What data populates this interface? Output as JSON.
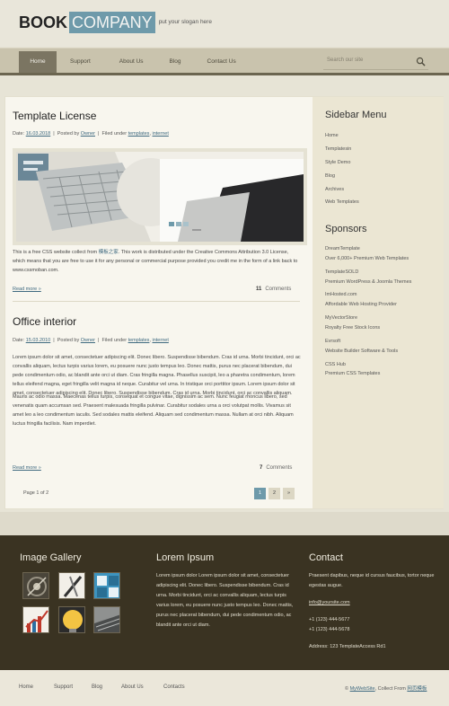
{
  "brand": {
    "word1": "BOOK",
    "word2": "COMPANY",
    "slogan": "put your slogan here"
  },
  "nav": {
    "items": [
      "Home",
      "Support",
      "About Us",
      "Blog",
      "Contact Us"
    ],
    "active": "Home"
  },
  "search": {
    "placeholder": "Search our site"
  },
  "posts": [
    {
      "title": "Template License",
      "date_label": "Date:",
      "date": "16.03.2018",
      "posted_label": "Posted by",
      "author": "Owner",
      "filed_label": "Filed under",
      "tag1": "templates",
      "tag2": "internet",
      "body_pre": "This is a free CSS website collect from",
      "body_link": "模板之家",
      "body_post": ". This work is distributed under the Creative Commons Attribution 3.0 License, which means that you are free to use it for any personal or commercial purpose provided you credit me in the form of a link back to www.cssmoban.com.",
      "read_more": "Read more »",
      "comments_count": "11",
      "comments_label": "Comments"
    },
    {
      "title": "Office interior",
      "date_label": "Date:",
      "date": "15.03.2010",
      "posted_label": "Posted by",
      "author": "Owner",
      "filed_label": "Filed under",
      "tag1": "templates",
      "tag2": "internet",
      "body1": "Lorem ipsum dolor sit amet, consectetuer adipiscing elit. Donec libero. Suspendisse bibendum. Cras id urna. Morbi tincidunt, orci ac convallis aliquam, lectus turpis varius lorem, eu posuere nunc justo tempus leo. Donec mattis, purus nec placerat bibendum, dui pede condimentum odio, ac blandit ante orci ut diam. Cras fringilla magna. Phasellus suscipit, leo a pharetra condimentum, lorem tellus eleifend magna, eget fringilla velit magna id neque. Curabitur vel urna. In tristique orci porttitor ipsum. Lorem ipsum dolor sit amet, consectetuer adipiscing elit. Donec libero. Suspendisse bibendum. Cras id urna. Morbi tincidunt, orci ac convallis aliquam.",
      "body2": "Mauris ac odio massa. Maecenas tellus turpis, consequat et congue vitae, dignissim ac sem. Nunc feugiat rhoncus libero, sed venenatis quam accumsan sed. Praesent malesuada fringilla pulvinar. Curabitur sodales urna a orci volutpat mollis. Vivamus sit amet leo a leo condimentum iaculis. Sed sodales mattis eleifend. Aliquam sed condimentum massa. Nullam at orci nibh. Aliquam luctus fringilla facilisis. Nam imperdiet.",
      "read_more": "Read more »",
      "comments_count": "7",
      "comments_label": "Comments"
    }
  ],
  "pagination": {
    "label": "Page 1 of 2",
    "pages": [
      "1",
      "2",
      "»"
    ],
    "current": "1"
  },
  "sidebar": {
    "menu_title": "Sidebar Menu",
    "menu": [
      "Home",
      "Templatesin",
      "Style Demo",
      "Blog",
      "Archives",
      "Web Templates"
    ],
    "sponsors_title": "Sponsors",
    "sponsors": [
      {
        "name": "DreamTemplate",
        "desc": "Over 6,000+ Premium Web Templates"
      },
      {
        "name": "TemplateSOLD",
        "desc": "Premium WordPress & Joomla Themes"
      },
      {
        "name": "ImHosted.com",
        "desc": "Affordable Web Hosting Provider"
      },
      {
        "name": "MyVectorStore",
        "desc": "Royalty Free Stock Icons"
      },
      {
        "name": "Evrsoft",
        "desc": "Website Builder Software & Tools"
      },
      {
        "name": "CSS Hub",
        "desc": "Premium CSS Templates"
      }
    ]
  },
  "footer": {
    "gallery_title": "Image Gallery",
    "lorem_title": "Lorem Ipsum",
    "lorem_text": "Lorem ipsum dolor Lorem ipsum dolor sit amet, consectetuer adipiscing elit. Donec libero. Suspendisse bibendum. Cras id urna. Morbi tincidunt, orci ac convallis aliquam, lectus turpis varius lorem, eu posuere nunc justo tempus leo. Donec mattis, purus nec placerat bibendum, dui pede condimentum odio, ac blandit ante orci ut diam.",
    "contact_title": "Contact",
    "contact_text": "Praesent dapibus, neque id cursus faucibus, tortor neque egestas augue.",
    "email": "info@yoursite.com",
    "phone1": "+1 (123) 444-5677",
    "phone2": "+1 (123) 444-5678",
    "address": "Address: 123 TemplateAccess Rd1"
  },
  "bottom": {
    "links": [
      "Home",
      "Support",
      "Blog",
      "About Us",
      "Contacts"
    ],
    "copy_pre": "©",
    "copy_link": "MyWebSite",
    "copy_mid": ", Collect From",
    "copy_link2": "网页模板"
  },
  "colors": {
    "accent": "#6e9aaa",
    "nav_bg": "#c9c3ad",
    "footer_bg": "#3a3322",
    "link": "#3f6a80"
  }
}
